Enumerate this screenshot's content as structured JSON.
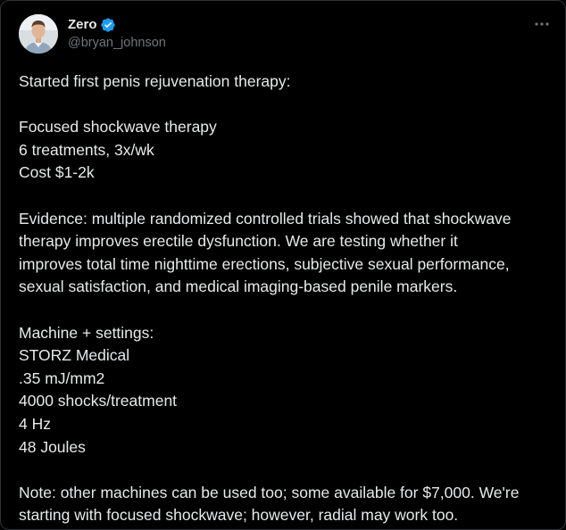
{
  "author": {
    "display_name": "Zero",
    "handle": "@bryan_johnson",
    "verified_icon": "verified-badge-icon",
    "avatar_icon": "avatar-portrait"
  },
  "menu": {
    "more_icon": "more-options-icon"
  },
  "colors": {
    "background": "#000000",
    "text": "#e7e9ea",
    "handle": "#71767b",
    "verified": "#1d9bf0"
  },
  "tweet": {
    "intro": "Started first penis rejuvenation therapy:",
    "therapy": [
      "Focused shockwave therapy",
      "6 treatments, 3x/wk",
      "Cost $1-2k"
    ],
    "evidence": [
      "Evidence: multiple randomized controlled trials showed that shockwave",
      "therapy improves erectile dysfunction. We are testing whether it",
      "improves total time nighttime erections, subjective sexual performance,",
      "sexual satisfaction, and medical imaging-based penile markers."
    ],
    "machine": [
      "Machine + settings:",
      "STORZ Medical",
      ".35 mJ/mm2",
      "4000 shocks/treatment",
      "4 Hz",
      "48 Joules"
    ],
    "note": [
      "Note: other machines can be used too; some available for $7,000. We're",
      "starting with focused shockwave; however, radial may work too."
    ]
  }
}
